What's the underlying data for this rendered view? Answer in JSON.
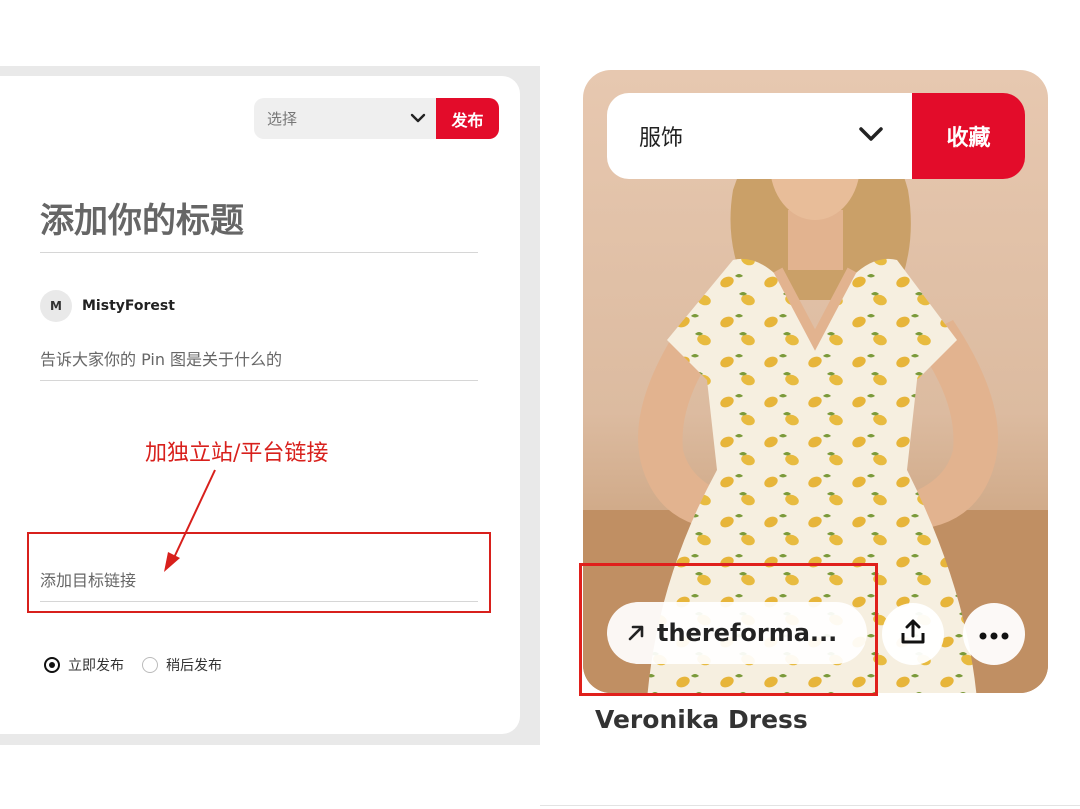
{
  "editor": {
    "board_select": {
      "placeholder": "选择",
      "icon": "chevron-down-icon"
    },
    "publish_label": "发布",
    "title_placeholder": "添加你的标题",
    "author": {
      "avatar_initial": "M",
      "name": "MistyForest"
    },
    "description_placeholder": "告诉大家你的 Pin 图是关于什么的",
    "link_placeholder": "添加目标链接",
    "schedule_options": [
      {
        "label": "立即发布",
        "selected": true
      },
      {
        "label": "稍后发布",
        "selected": false
      }
    ]
  },
  "annotation": {
    "text": "加独立站/平台链接",
    "color": "#d8201c"
  },
  "pin_preview": {
    "board_select_label": "服饰",
    "save_label": "收藏",
    "link_label": "thereforma...",
    "title": "Veronika Dress",
    "icons": [
      "chevron-down-icon",
      "arrow-up-right-icon",
      "share-icon",
      "more-icon"
    ]
  },
  "colors": {
    "brand_red": "#e30c2a",
    "highlight_red": "#e0201c"
  }
}
